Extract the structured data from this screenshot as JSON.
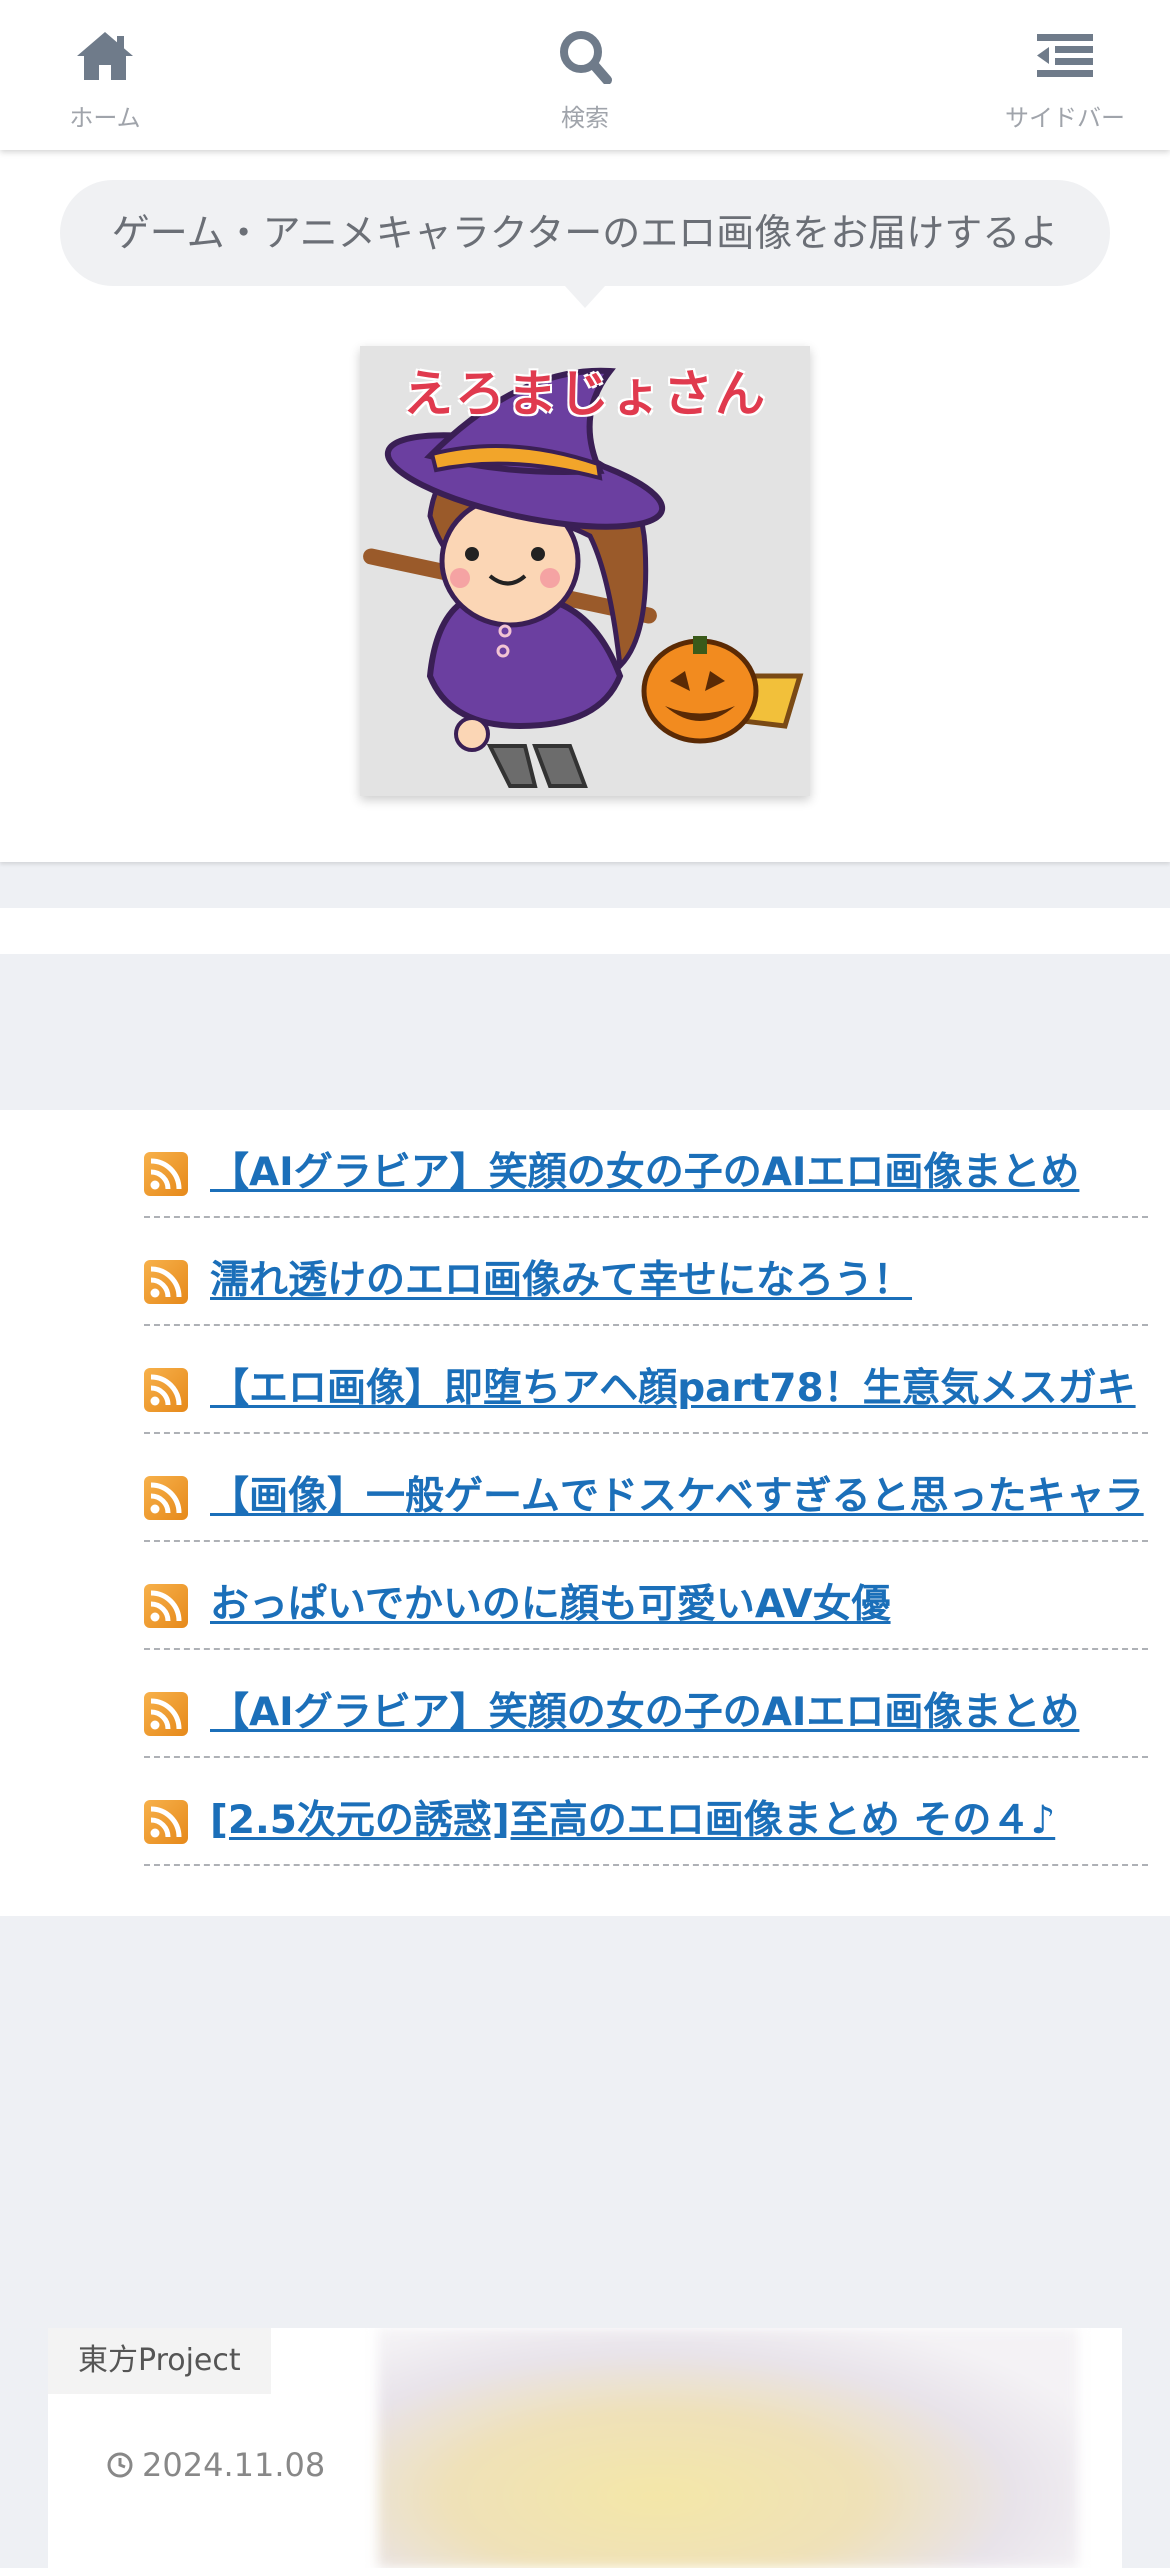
{
  "nav": {
    "home_label": "ホーム",
    "search_label": "検索",
    "sidebar_label": "サイドバー"
  },
  "header": {
    "tagline": "ゲーム・アニメキャラクターのエロ画像をお届けするよ",
    "logo_text": "えろまじょさん"
  },
  "feed": {
    "items": [
      {
        "title": "【AIグラビア】笑顔の女の子のAIエロ画像まとめ"
      },
      {
        "title": "濡れ透けのエロ画像みて幸せになろう！"
      },
      {
        "title": "【エロ画像】即堕ちアヘ顔part78！生意気メスガキ"
      },
      {
        "title": "【画像】一般ゲームでドスケベすぎると思ったキャラ"
      },
      {
        "title": "おっぱいでかいのに顔も可愛いAV女優"
      },
      {
        "title": "【AIグラビア】笑顔の女の子のAIエロ画像まとめ"
      },
      {
        "title": "[2.5次元の誘惑]至高のエロ画像まとめ その４♪"
      }
    ]
  },
  "card": {
    "category": "東方Project",
    "date": "2024.11.08"
  },
  "colors": {
    "link": "#1b6fb9",
    "nav_icon": "#6f7b8a",
    "rss": "#f0a030",
    "background": "#eef0f4"
  },
  "icons": {
    "home": "home-icon",
    "search": "search-icon",
    "sidebar": "sidebar-menu-icon",
    "rss": "rss-icon",
    "clock": "clock-icon"
  }
}
